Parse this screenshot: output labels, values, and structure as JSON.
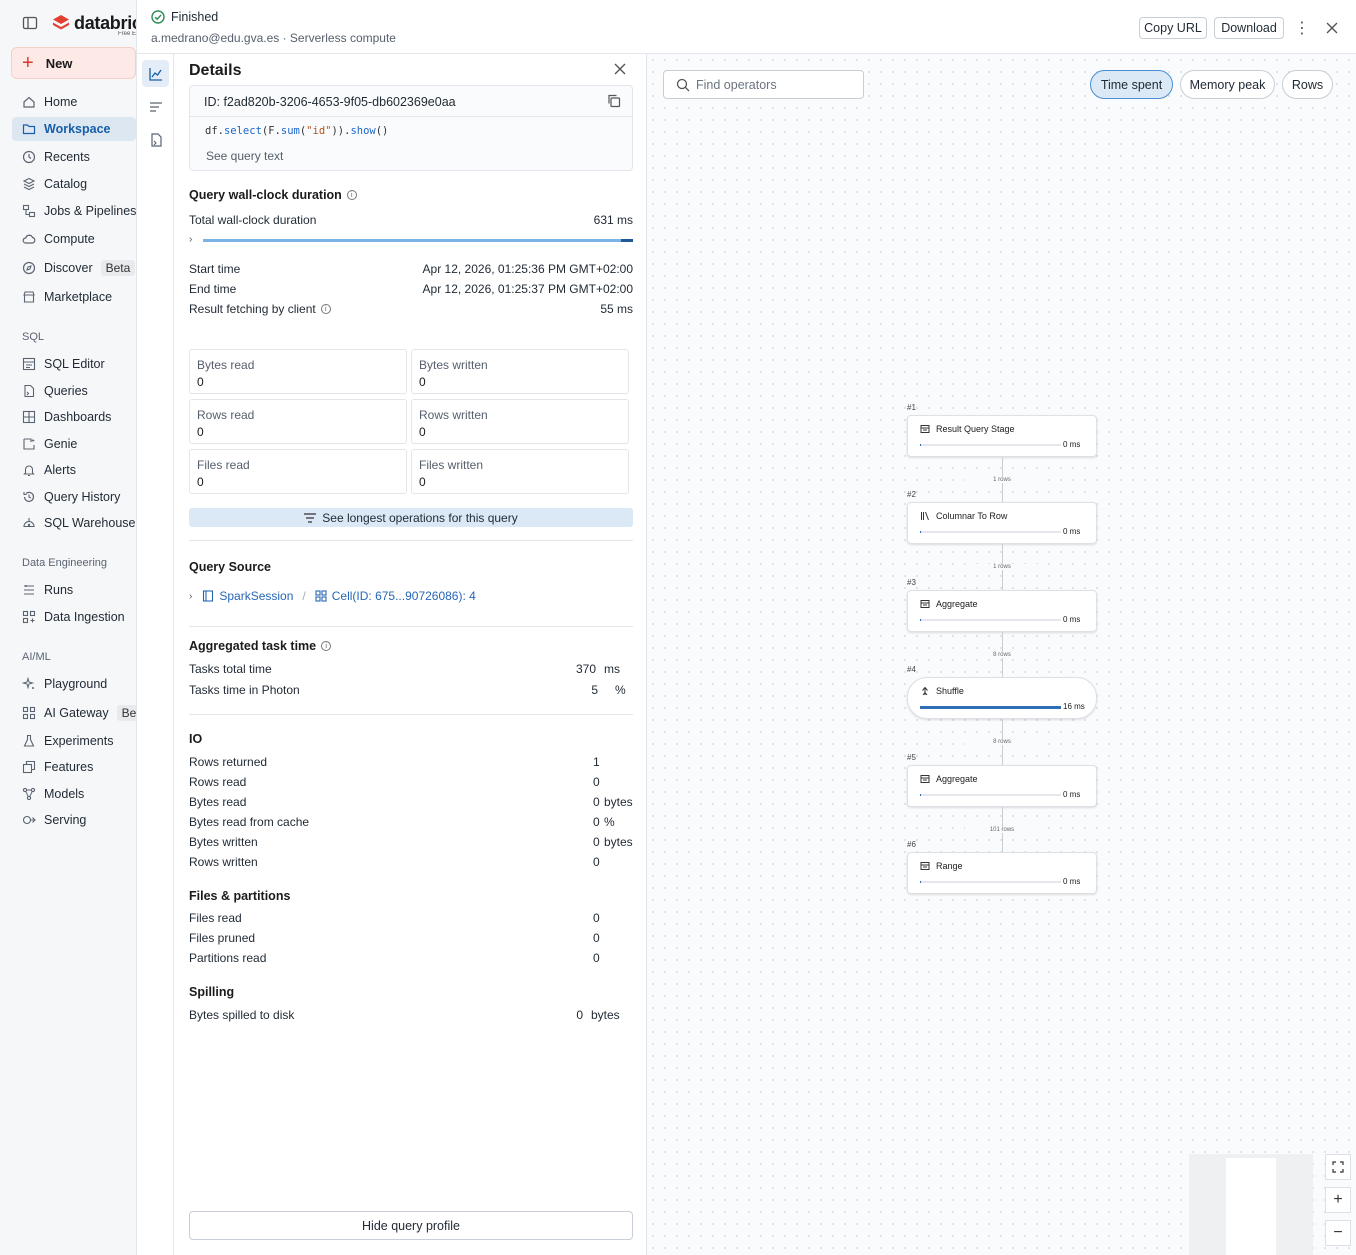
{
  "sidebar": {
    "logo_text": "databricks",
    "logo_sub": "Free Edition",
    "new_label": "New",
    "items": [
      {
        "label": "Home",
        "icon": "home-icon"
      },
      {
        "label": "Workspace",
        "icon": "folder-icon",
        "active": true
      },
      {
        "label": "Recents",
        "icon": "clock-icon"
      },
      {
        "label": "Catalog",
        "icon": "catalog-icon"
      },
      {
        "label": "Jobs & Pipelines",
        "icon": "jobs-icon"
      },
      {
        "label": "Compute",
        "icon": "cloud-icon"
      },
      {
        "label": "Discover",
        "icon": "compass-icon",
        "badge": "Beta"
      },
      {
        "label": "Marketplace",
        "icon": "store-icon"
      }
    ],
    "sql_section": "SQL",
    "sql_items": [
      {
        "label": "SQL Editor",
        "icon": "editor-icon"
      },
      {
        "label": "Queries",
        "icon": "query-icon"
      },
      {
        "label": "Dashboards",
        "icon": "dashboard-icon"
      },
      {
        "label": "Genie",
        "icon": "genie-icon"
      },
      {
        "label": "Alerts",
        "icon": "bell-icon"
      },
      {
        "label": "Query History",
        "icon": "history-icon"
      },
      {
        "label": "SQL Warehouses",
        "icon": "warehouse-icon"
      }
    ],
    "de_section": "Data Engineering",
    "de_items": [
      {
        "label": "Runs",
        "icon": "runs-icon"
      },
      {
        "label": "Data Ingestion",
        "icon": "ingestion-icon"
      }
    ],
    "ml_section": "AI/ML",
    "ml_items": [
      {
        "label": "Playground",
        "icon": "sparkle-icon"
      },
      {
        "label": "AI Gateway",
        "icon": "gateway-icon",
        "badge": "Beta"
      },
      {
        "label": "Experiments",
        "icon": "flask-icon"
      },
      {
        "label": "Features",
        "icon": "features-icon"
      },
      {
        "label": "Models",
        "icon": "models-icon"
      },
      {
        "label": "Serving",
        "icon": "serving-icon"
      }
    ]
  },
  "header": {
    "status": "Finished",
    "subline": "a.medrano@edu.gva.es · Serverless compute",
    "copy_url": "Copy URL",
    "download": "Download"
  },
  "details": {
    "title": "Details",
    "query_id": "ID: f2ad820b-3206-4653-9f05-db602369e0aa",
    "code": {
      "p1": "df.",
      "p2": "select",
      "p3": "(F.",
      "p4": "sum",
      "p5": "(",
      "p6": "\"id\"",
      "p7": ")).",
      "p8": "show",
      "p9": "()"
    },
    "see_query_text": "See query text",
    "wallclock_title": "Query wall-clock duration",
    "total_label": "Total wall-clock duration",
    "total_value": "631 ms",
    "start_label": "Start time",
    "start_value": "Apr 12, 2026, 01:25:36 PM GMT+02:00",
    "end_label": "End time",
    "end_value": "Apr 12, 2026, 01:25:37 PM GMT+02:00",
    "fetch_label": "Result fetching by client",
    "fetch_value": "55 ms",
    "stats": [
      {
        "label": "Bytes read",
        "value": "0"
      },
      {
        "label": "Bytes written",
        "value": "0"
      },
      {
        "label": "Rows read",
        "value": "0"
      },
      {
        "label": "Rows written",
        "value": "0"
      },
      {
        "label": "Files read",
        "value": "0"
      },
      {
        "label": "Files written",
        "value": "0"
      }
    ],
    "longest_ops": "See longest operations for this query",
    "query_source_title": "Query Source",
    "source_session": "SparkSession",
    "source_cell": "Cell(ID: 675...90726086): 4",
    "agg_title": "Aggregated task time",
    "tasks_total_label": "Tasks total time",
    "tasks_total_value": "370",
    "tasks_total_unit": "ms",
    "photon_label": "Tasks time in Photon",
    "photon_value": "5",
    "photon_unit": "%",
    "io_title": "IO",
    "io_rows": [
      {
        "label": "Rows returned",
        "value": "1",
        "unit": ""
      },
      {
        "label": "Rows read",
        "value": "0",
        "unit": ""
      },
      {
        "label": "Bytes read",
        "value": "0",
        "unit": "bytes"
      },
      {
        "label": "Bytes read from cache",
        "value": "0",
        "unit": "%"
      },
      {
        "label": "Bytes written",
        "value": "0",
        "unit": "bytes"
      },
      {
        "label": "Rows written",
        "value": "0",
        "unit": ""
      }
    ],
    "files_title": "Files & partitions",
    "files_rows": [
      {
        "label": "Files read",
        "value": "0"
      },
      {
        "label": "Files pruned",
        "value": "0"
      },
      {
        "label": "Partitions read",
        "value": "0"
      }
    ],
    "spill_title": "Spilling",
    "spill_label": "Bytes spilled to disk",
    "spill_value": "0",
    "spill_unit": "bytes",
    "hide_profile": "Hide query profile"
  },
  "graph": {
    "find_placeholder": "Find operators",
    "pills": [
      "Time spent",
      "Memory peak",
      "Rows"
    ],
    "nodes": [
      {
        "num": "#1",
        "name": "Result Query Stage",
        "value": "0 ms",
        "fraction": 0
      },
      {
        "num": "#2",
        "name": "Columnar To Row",
        "value": "0 ms",
        "fraction": 0
      },
      {
        "num": "#3",
        "name": "Aggregate",
        "value": "0 ms",
        "fraction": 0
      },
      {
        "num": "#4",
        "name": "Shuffle",
        "value": "16 ms",
        "fraction": 1
      },
      {
        "num": "#5",
        "name": "Aggregate",
        "value": "0 ms",
        "fraction": 0
      },
      {
        "num": "#6",
        "name": "Range",
        "value": "0 ms",
        "fraction": 0
      }
    ],
    "edges": [
      "1 rows",
      "1 rows",
      "8 rows",
      "8 rows",
      "101 rows"
    ],
    "zoom_in": "+",
    "zoom_out": "−"
  }
}
